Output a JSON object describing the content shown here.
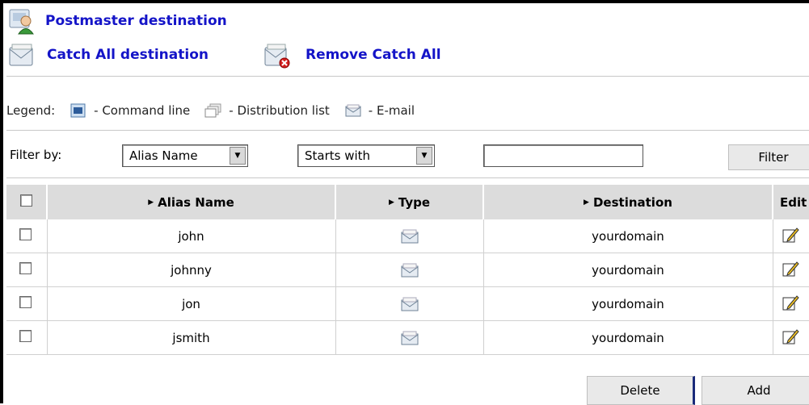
{
  "actions": {
    "postmaster_label": "Postmaster destination",
    "catch_all_label": "Catch All destination",
    "remove_catch_all_label": "Remove Catch All"
  },
  "legend": {
    "title": "Legend:",
    "command_line": "- Command line",
    "distribution_list": "- Distribution list",
    "email": "- E-mail"
  },
  "filter": {
    "label": "Filter by:",
    "field_select": "Alias Name",
    "condition_select": "Starts with",
    "value": "",
    "button": "Filter"
  },
  "table": {
    "columns": [
      "Alias Name",
      "Type",
      "Destination",
      "Edit"
    ],
    "rows": [
      {
        "alias": "john",
        "type_icon": "email-icon",
        "destination": "yourdomain"
      },
      {
        "alias": "johnny",
        "type_icon": "email-icon",
        "destination": "yourdomain"
      },
      {
        "alias": "jon",
        "type_icon": "email-icon",
        "destination": "yourdomain"
      },
      {
        "alias": "jsmith",
        "type_icon": "email-icon",
        "destination": "yourdomain"
      }
    ]
  },
  "buttons": {
    "delete": "Delete",
    "add": "Add"
  },
  "colors": {
    "link": "#1414c8",
    "header_bg": "#dcdcdc",
    "divider": "#c8c8c8"
  }
}
